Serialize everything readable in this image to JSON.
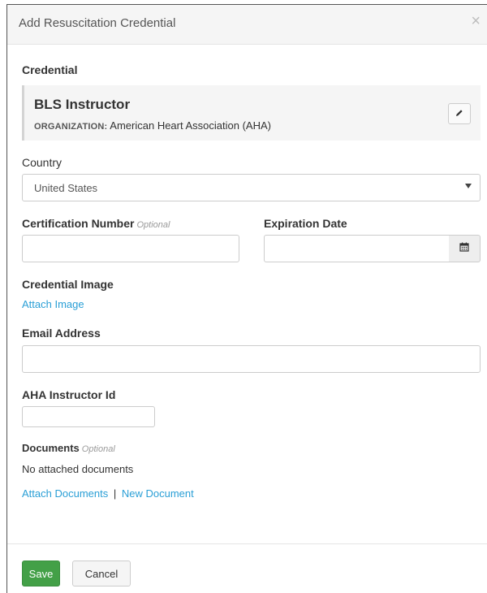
{
  "modal": {
    "title": "Add Resuscitation Credential",
    "close_glyph": "×"
  },
  "credential": {
    "section_label": "Credential",
    "name": "BLS Instructor",
    "organization_label": "ORGANIZATION:",
    "organization_value": "American Heart Association (AHA)",
    "edit_icon": "pencil-icon"
  },
  "country": {
    "label": "Country",
    "selected": "United States"
  },
  "certification_number": {
    "label": "Certification Number",
    "optional": "Optional",
    "value": ""
  },
  "expiration_date": {
    "label": "Expiration Date",
    "value": "",
    "icon": "calendar-icon"
  },
  "credential_image": {
    "label": "Credential Image",
    "attach_link": "Attach Image"
  },
  "email": {
    "label": "Email Address",
    "value": ""
  },
  "aha_instructor_id": {
    "label": "AHA Instructor Id",
    "value": ""
  },
  "documents": {
    "label": "Documents",
    "optional": "Optional",
    "empty_text": "No attached documents",
    "attach_link": "Attach Documents",
    "separator": "|",
    "new_link": "New Document"
  },
  "footer": {
    "save_label": "Save",
    "cancel_label": "Cancel"
  },
  "colors": {
    "link": "#2a9fd6",
    "save_button": "#43a047",
    "header_bg": "#f5f5f5"
  }
}
